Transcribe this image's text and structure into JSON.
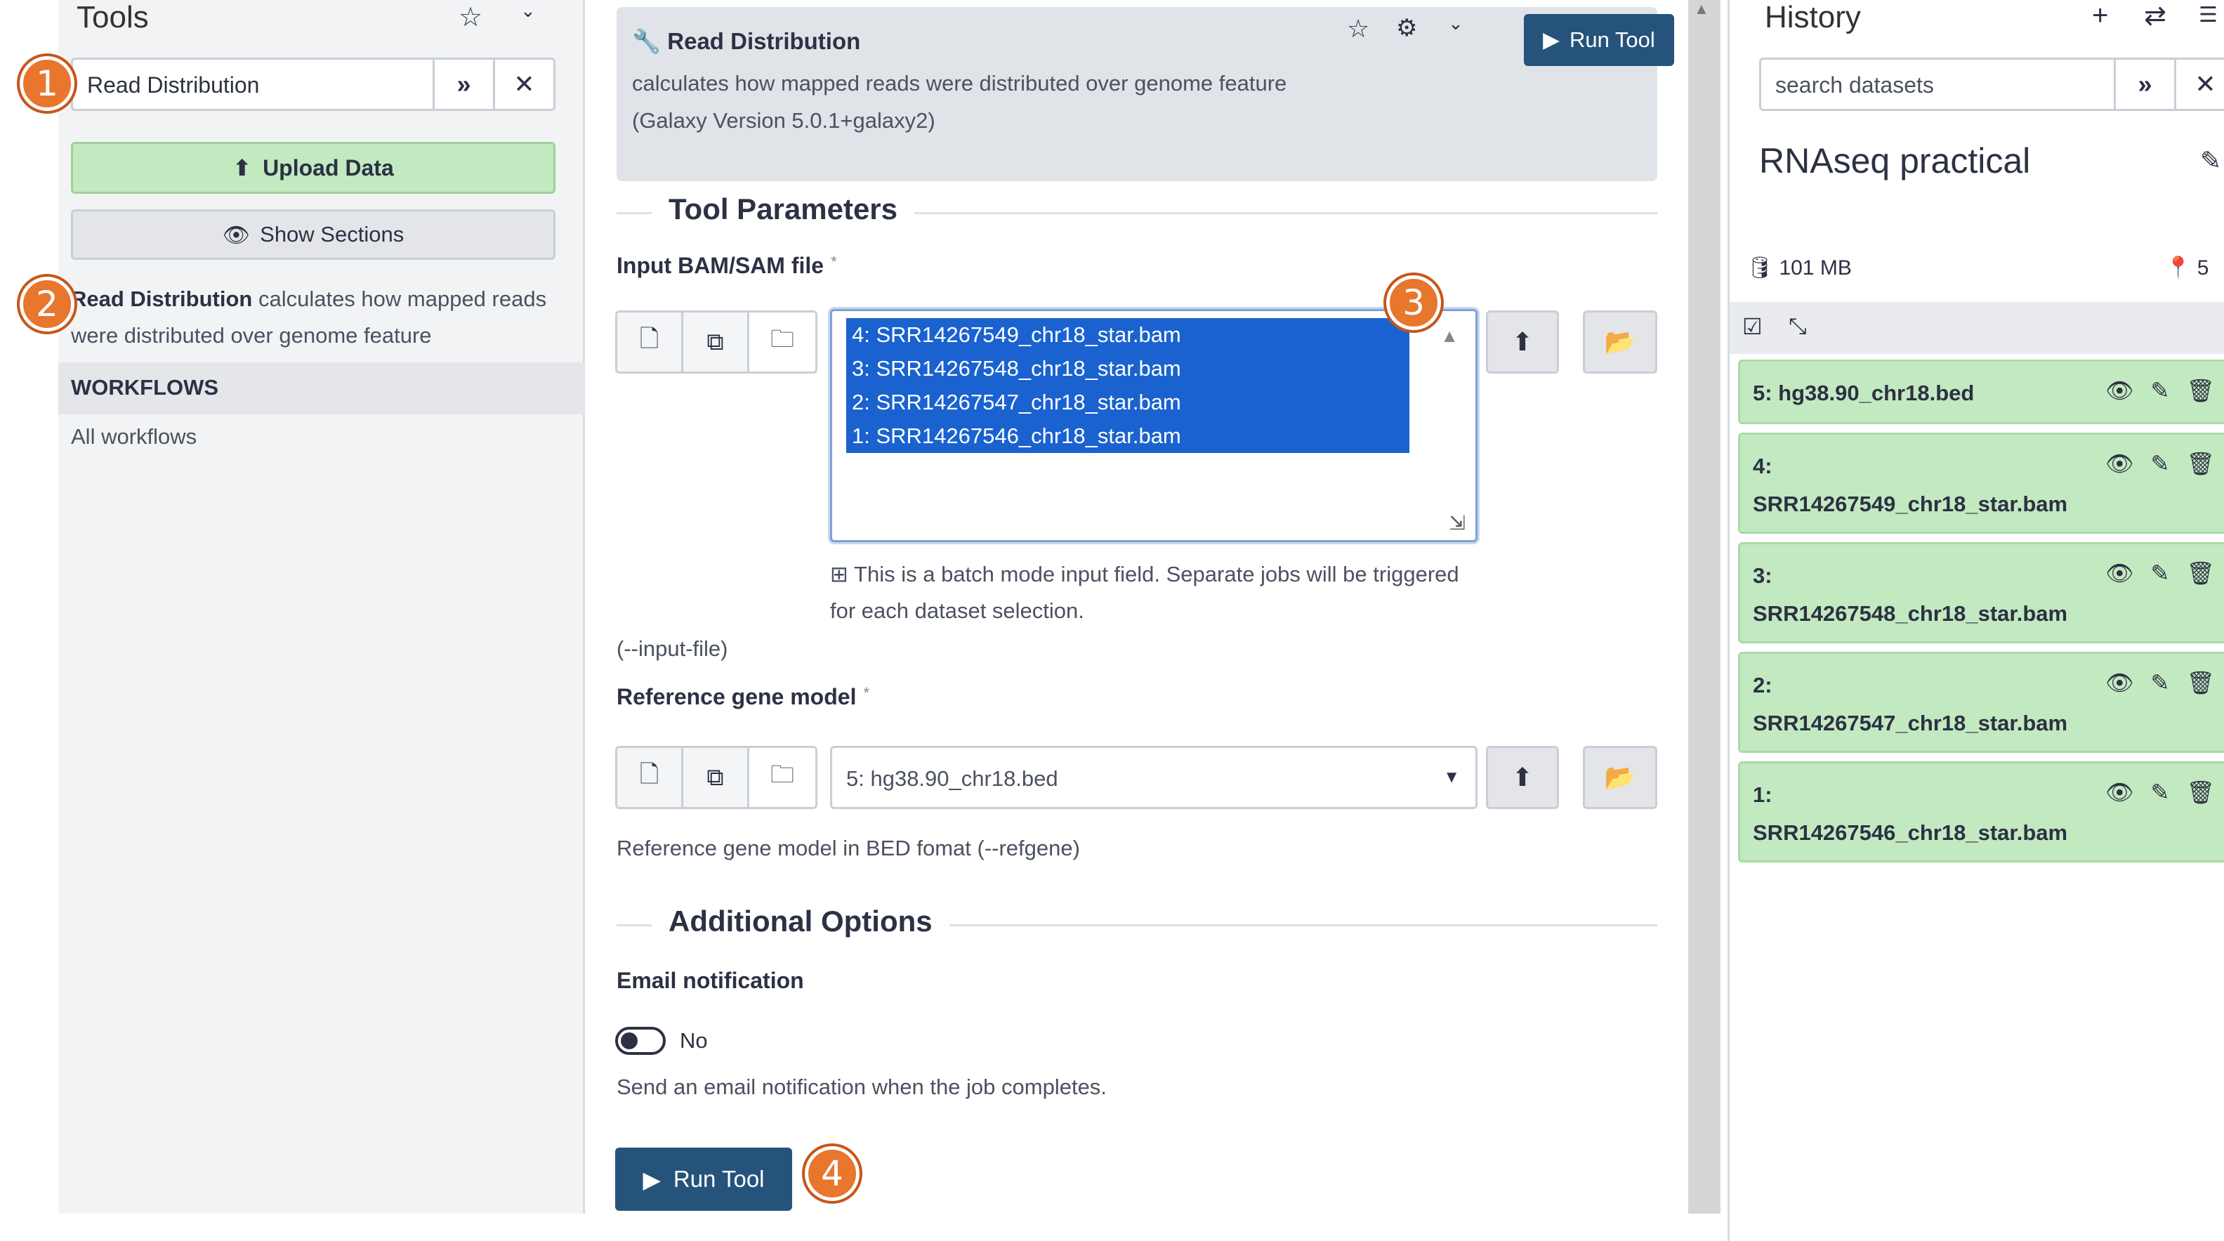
{
  "left": {
    "title": "Tools",
    "search_value": "Read Distribution",
    "upload_label": "Upload Data",
    "show_sections_label": "Show Sections",
    "result_name": "Read Distribution",
    "result_desc": " calculates how mapped reads were distributed over genome feature",
    "workflows_header": "WORKFLOWS",
    "all_workflows": "All workflows"
  },
  "tool": {
    "name": "Read Distribution",
    "description": "calculates how mapped reads were distributed over genome feature",
    "version": "(Galaxy Version 5.0.1+galaxy2)",
    "run_label": "Run Tool"
  },
  "params": {
    "section_title": "Tool Parameters",
    "input_label": "Input BAM/SAM file",
    "required_mark": "*",
    "input_options": [
      "4: SRR14267549_chr18_star.bam",
      "3: SRR14267548_chr18_star.bam",
      "2: SRR14267547_chr18_star.bam",
      "1: SRR14267546_chr18_star.bam"
    ],
    "batch_note": "This is a batch mode input field. Separate jobs will be triggered for each dataset selection.",
    "input_help": "(--input-file)",
    "ref_label": "Reference gene model",
    "ref_value": "5: hg38.90_chr18.bed",
    "ref_help": "Reference gene model in BED fomat (--refgene)"
  },
  "additional": {
    "section_title": "Additional Options",
    "email_label": "Email notification",
    "toggle_value": "No",
    "email_help": "Send an email notification when the job completes.",
    "run_label": "Run Tool"
  },
  "callouts": [
    "1",
    "2",
    "3",
    "4"
  ],
  "history": {
    "title": "History",
    "search_placeholder": "search datasets",
    "name": "RNAseq practical",
    "size": "101 MB",
    "count": "5",
    "datasets": [
      "5: hg38.90_chr18.bed",
      "4: SRR14267549_chr18_star.bam",
      "3: SRR14267548_chr18_star.bam",
      "2: SRR14267547_chr18_star.bam",
      "1: SRR14267546_chr18_star.bam"
    ]
  },
  "colors": {
    "accent_green": "#c3e9c1",
    "run_button": "#25537b",
    "selection_blue": "#1a62d0",
    "callout_orange": "#e8762d"
  }
}
